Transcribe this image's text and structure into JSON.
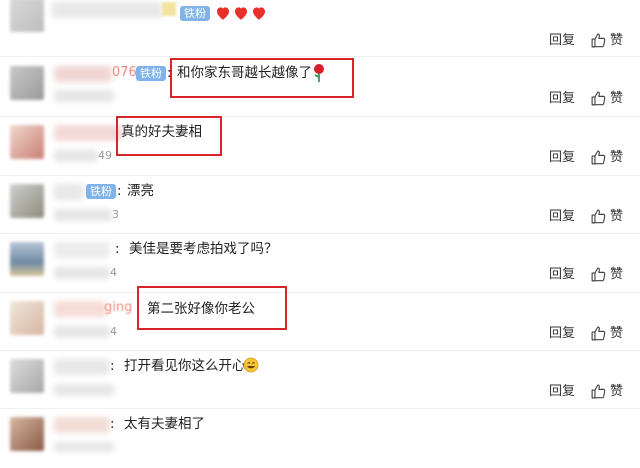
{
  "actions": {
    "reply_label": "回复",
    "like_label": "赞"
  },
  "badge_label": "铁粉",
  "comments": [
    {
      "user_suffix": "",
      "text": "",
      "time_suffix": "",
      "hearts": 3
    },
    {
      "user_suffix": "076",
      "text": "和你家东哥越长越像了",
      "time_suffix": "",
      "has_rose": true
    },
    {
      "user_suffix": "",
      "text": "真的好夫妻相",
      "time_suffix": "49"
    },
    {
      "user_suffix": "",
      "text": "漂亮",
      "time_suffix": "3"
    },
    {
      "user_suffix": "",
      "text": "美佳是要考虑拍戏了吗？",
      "time_suffix": "4"
    },
    {
      "user_suffix": "ging",
      "text": "第二张好像你老公",
      "time_suffix": "4"
    },
    {
      "user_suffix": "",
      "text": "打开看见你这么开心",
      "time_suffix": "",
      "has_emoji": true
    },
    {
      "user_suffix": "",
      "text": "太有夫妻相了",
      "time_suffix": "",
      "partial": true
    }
  ]
}
